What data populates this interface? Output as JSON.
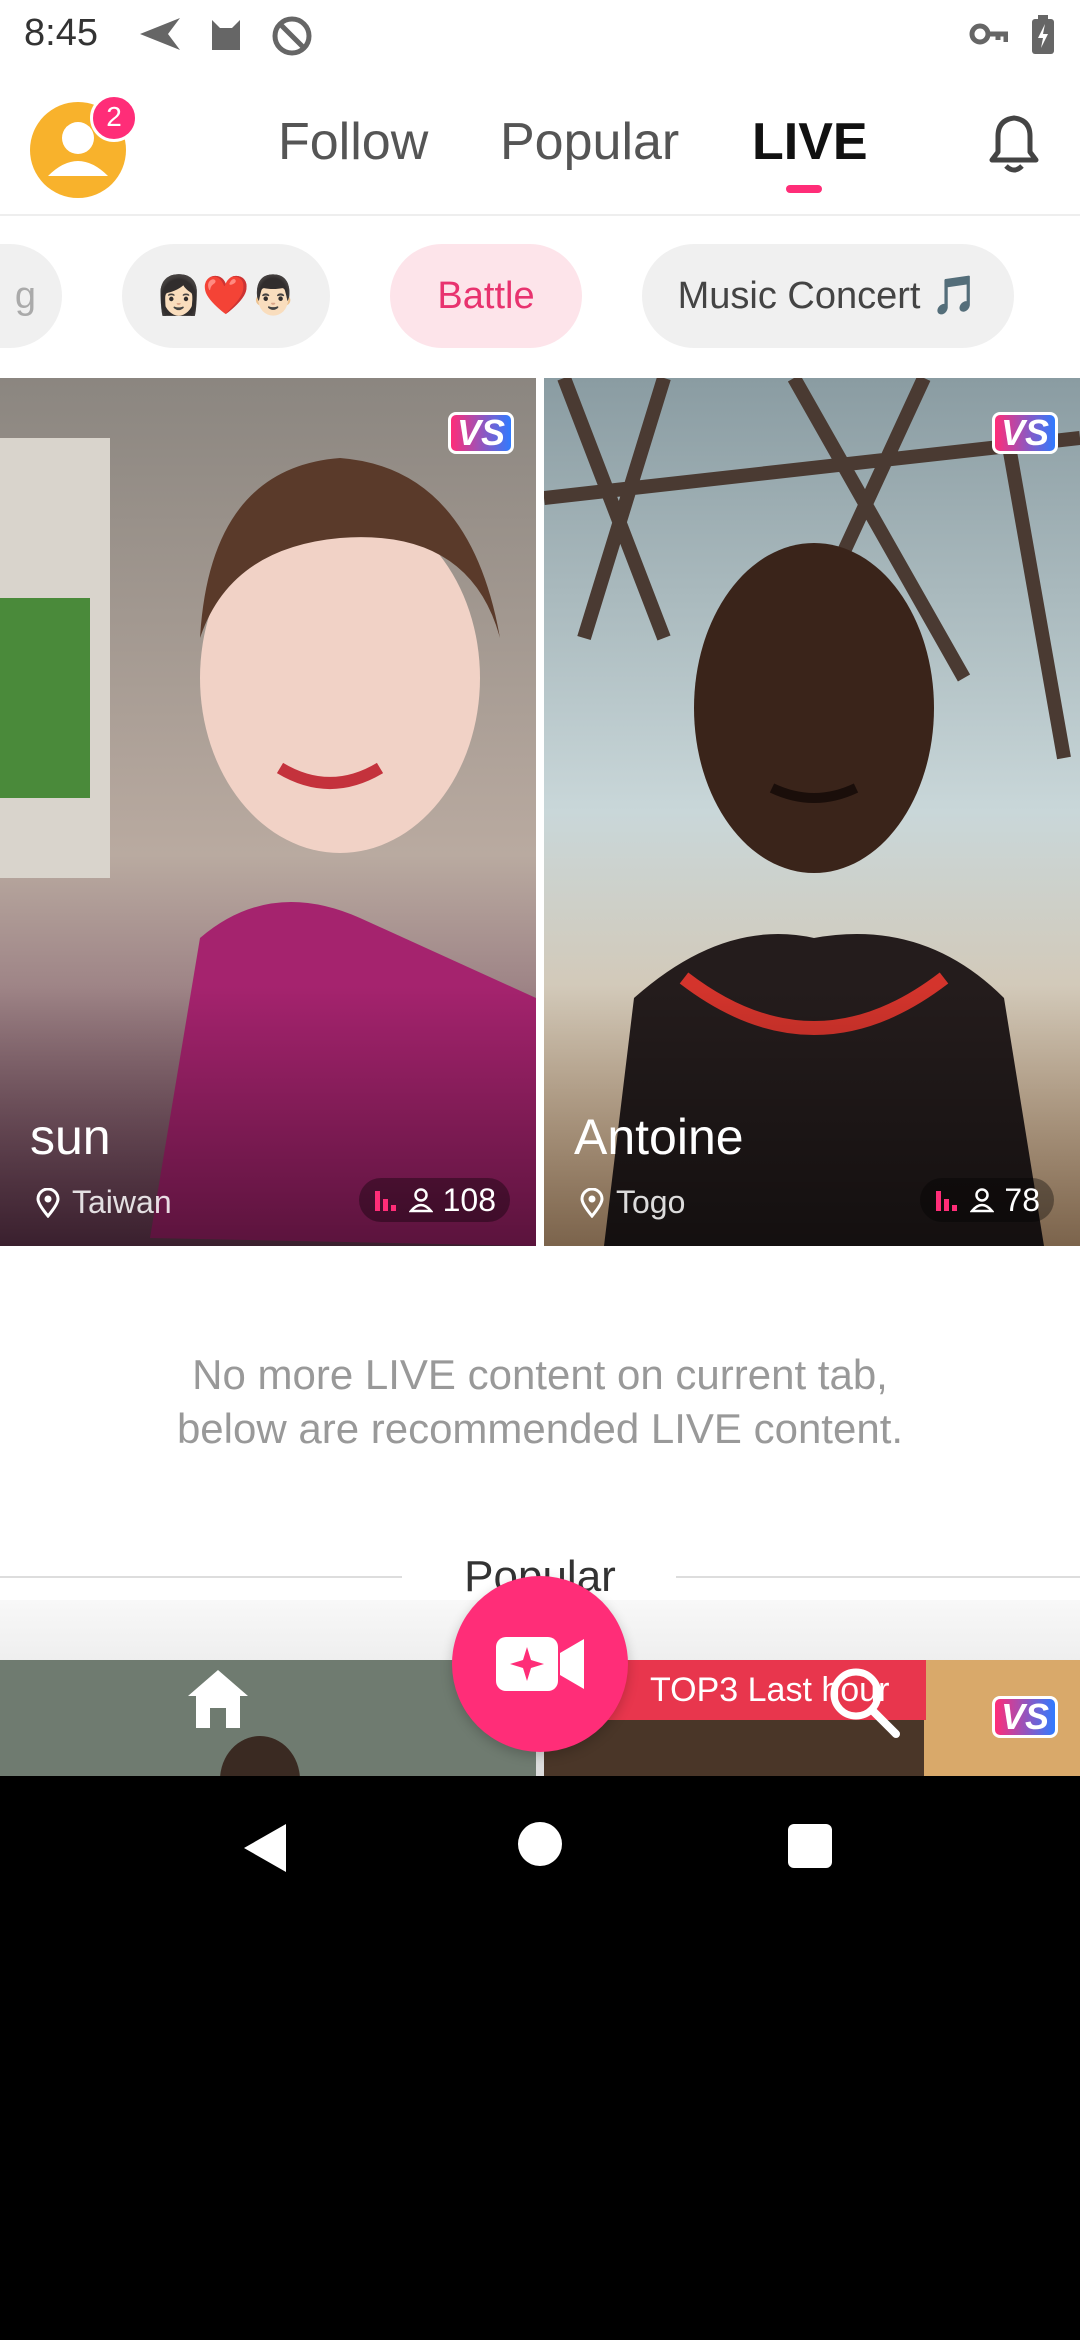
{
  "status": {
    "time": "8:45"
  },
  "header": {
    "badge_count": "2",
    "tabs": [
      {
        "label": "Follow"
      },
      {
        "label": "Popular"
      },
      {
        "label": "LIVE"
      }
    ]
  },
  "chips": [
    {
      "label": "g"
    },
    {
      "label": "👩🏻❤️👨🏻"
    },
    {
      "label": "Battle"
    },
    {
      "label": "Music Concert 🎵"
    }
  ],
  "cards": [
    {
      "name": "sun",
      "location": "Taiwan",
      "viewers": "108",
      "vs": "VS"
    },
    {
      "name": "Antoine",
      "location": "Togo",
      "viewers": "78",
      "vs": "VS"
    }
  ],
  "info": {
    "line1": "No more LIVE content on current tab,",
    "line2": "below are recommended LIVE content."
  },
  "popular_label": "Popular",
  "peek": {
    "top3_label": "TOP3 Last hour",
    "vs": "VS"
  },
  "colors": {
    "accent": "#ff2d78",
    "avatar": "#f8b22c",
    "chip_bg": "#f0f0f0",
    "battle_bg": "#fde4ea"
  }
}
